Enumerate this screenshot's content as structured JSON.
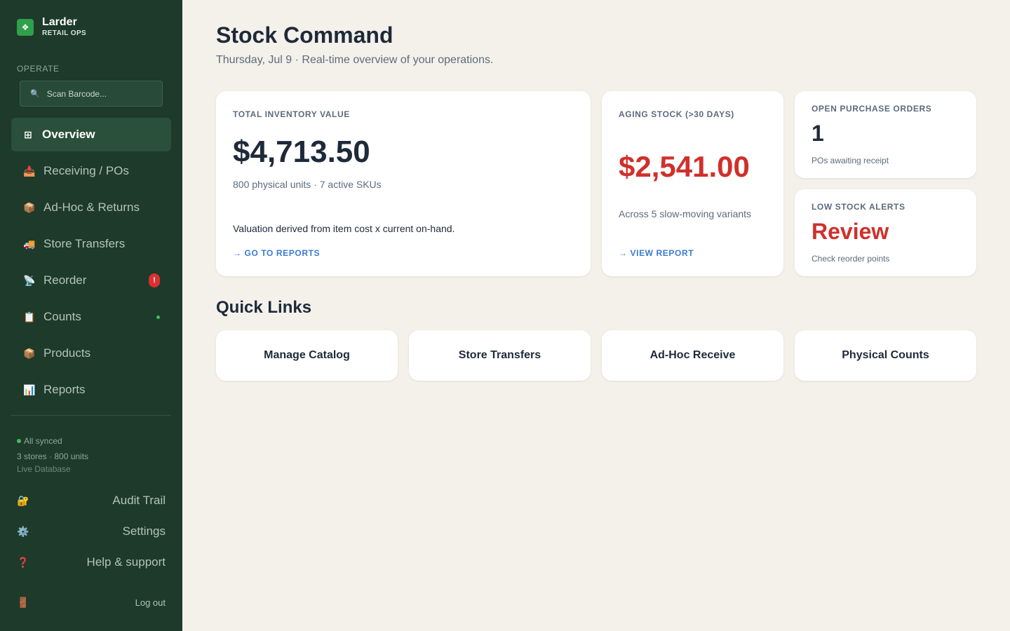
{
  "brand": {
    "name": "Larder",
    "subtitle": "RETAIL OPS",
    "logo_icon": "diamond-icon"
  },
  "sidebar": {
    "section_label": "OPERATE",
    "scan_placeholder": "Scan Barcode...",
    "items": [
      {
        "label": "Overview",
        "icon": "grid-icon",
        "active": true
      },
      {
        "label": "Receiving / POs",
        "icon": "inbox-icon"
      },
      {
        "label": "Ad-Hoc & Returns",
        "icon": "package-icon"
      },
      {
        "label": "Store Transfers",
        "icon": "truck-icon"
      },
      {
        "label": "Reorder",
        "icon": "satellite-icon",
        "badge": "!"
      },
      {
        "label": "Counts",
        "icon": "clipboard-icon",
        "dot": true
      },
      {
        "label": "Products",
        "icon": "package-icon"
      },
      {
        "label": "Reports",
        "icon": "bar-chart-icon"
      }
    ],
    "sync_status": "All synced",
    "sync_detail": "3 stores · 800 units",
    "sync_source": "Live Database",
    "audit_trail": "Audit Trail",
    "settings": "Settings",
    "help": "Help & support",
    "logout": "Log out"
  },
  "header": {
    "title": "Stock Command",
    "subtitle": "Thursday, Jul 9 · Real-time overview of your operations."
  },
  "cards": {
    "inventory": {
      "label": "TOTAL INVENTORY VALUE",
      "value": "$4,713.50",
      "detail": "800 physical units · 7 active SKUs",
      "note": "Valuation derived from item cost x current on-hand.",
      "link": "→ GO TO REPORTS"
    },
    "aging": {
      "label": "AGING STOCK (>30 DAYS)",
      "value": "$2,541.00",
      "detail": "Across 5 slow-moving variants",
      "link": "→ VIEW REPORT"
    },
    "open_pos": {
      "label": "OPEN PURCHASE ORDERS",
      "value": "1",
      "detail": "POs awaiting receipt"
    },
    "low_stock": {
      "label": "LOW STOCK ALERTS",
      "value": "Review",
      "detail": "Check reorder points"
    }
  },
  "quick_links": {
    "title": "Quick Links",
    "items": [
      "Manage Catalog",
      "Store Transfers",
      "Ad-Hoc Receive",
      "Physical Counts"
    ]
  },
  "colors": {
    "sidebar_bg": "#1d3a2b",
    "accent_green": "#2fa04b",
    "alert_red": "#d0302c",
    "link_blue": "#3a7bd5",
    "page_bg": "#f4f1ea"
  }
}
